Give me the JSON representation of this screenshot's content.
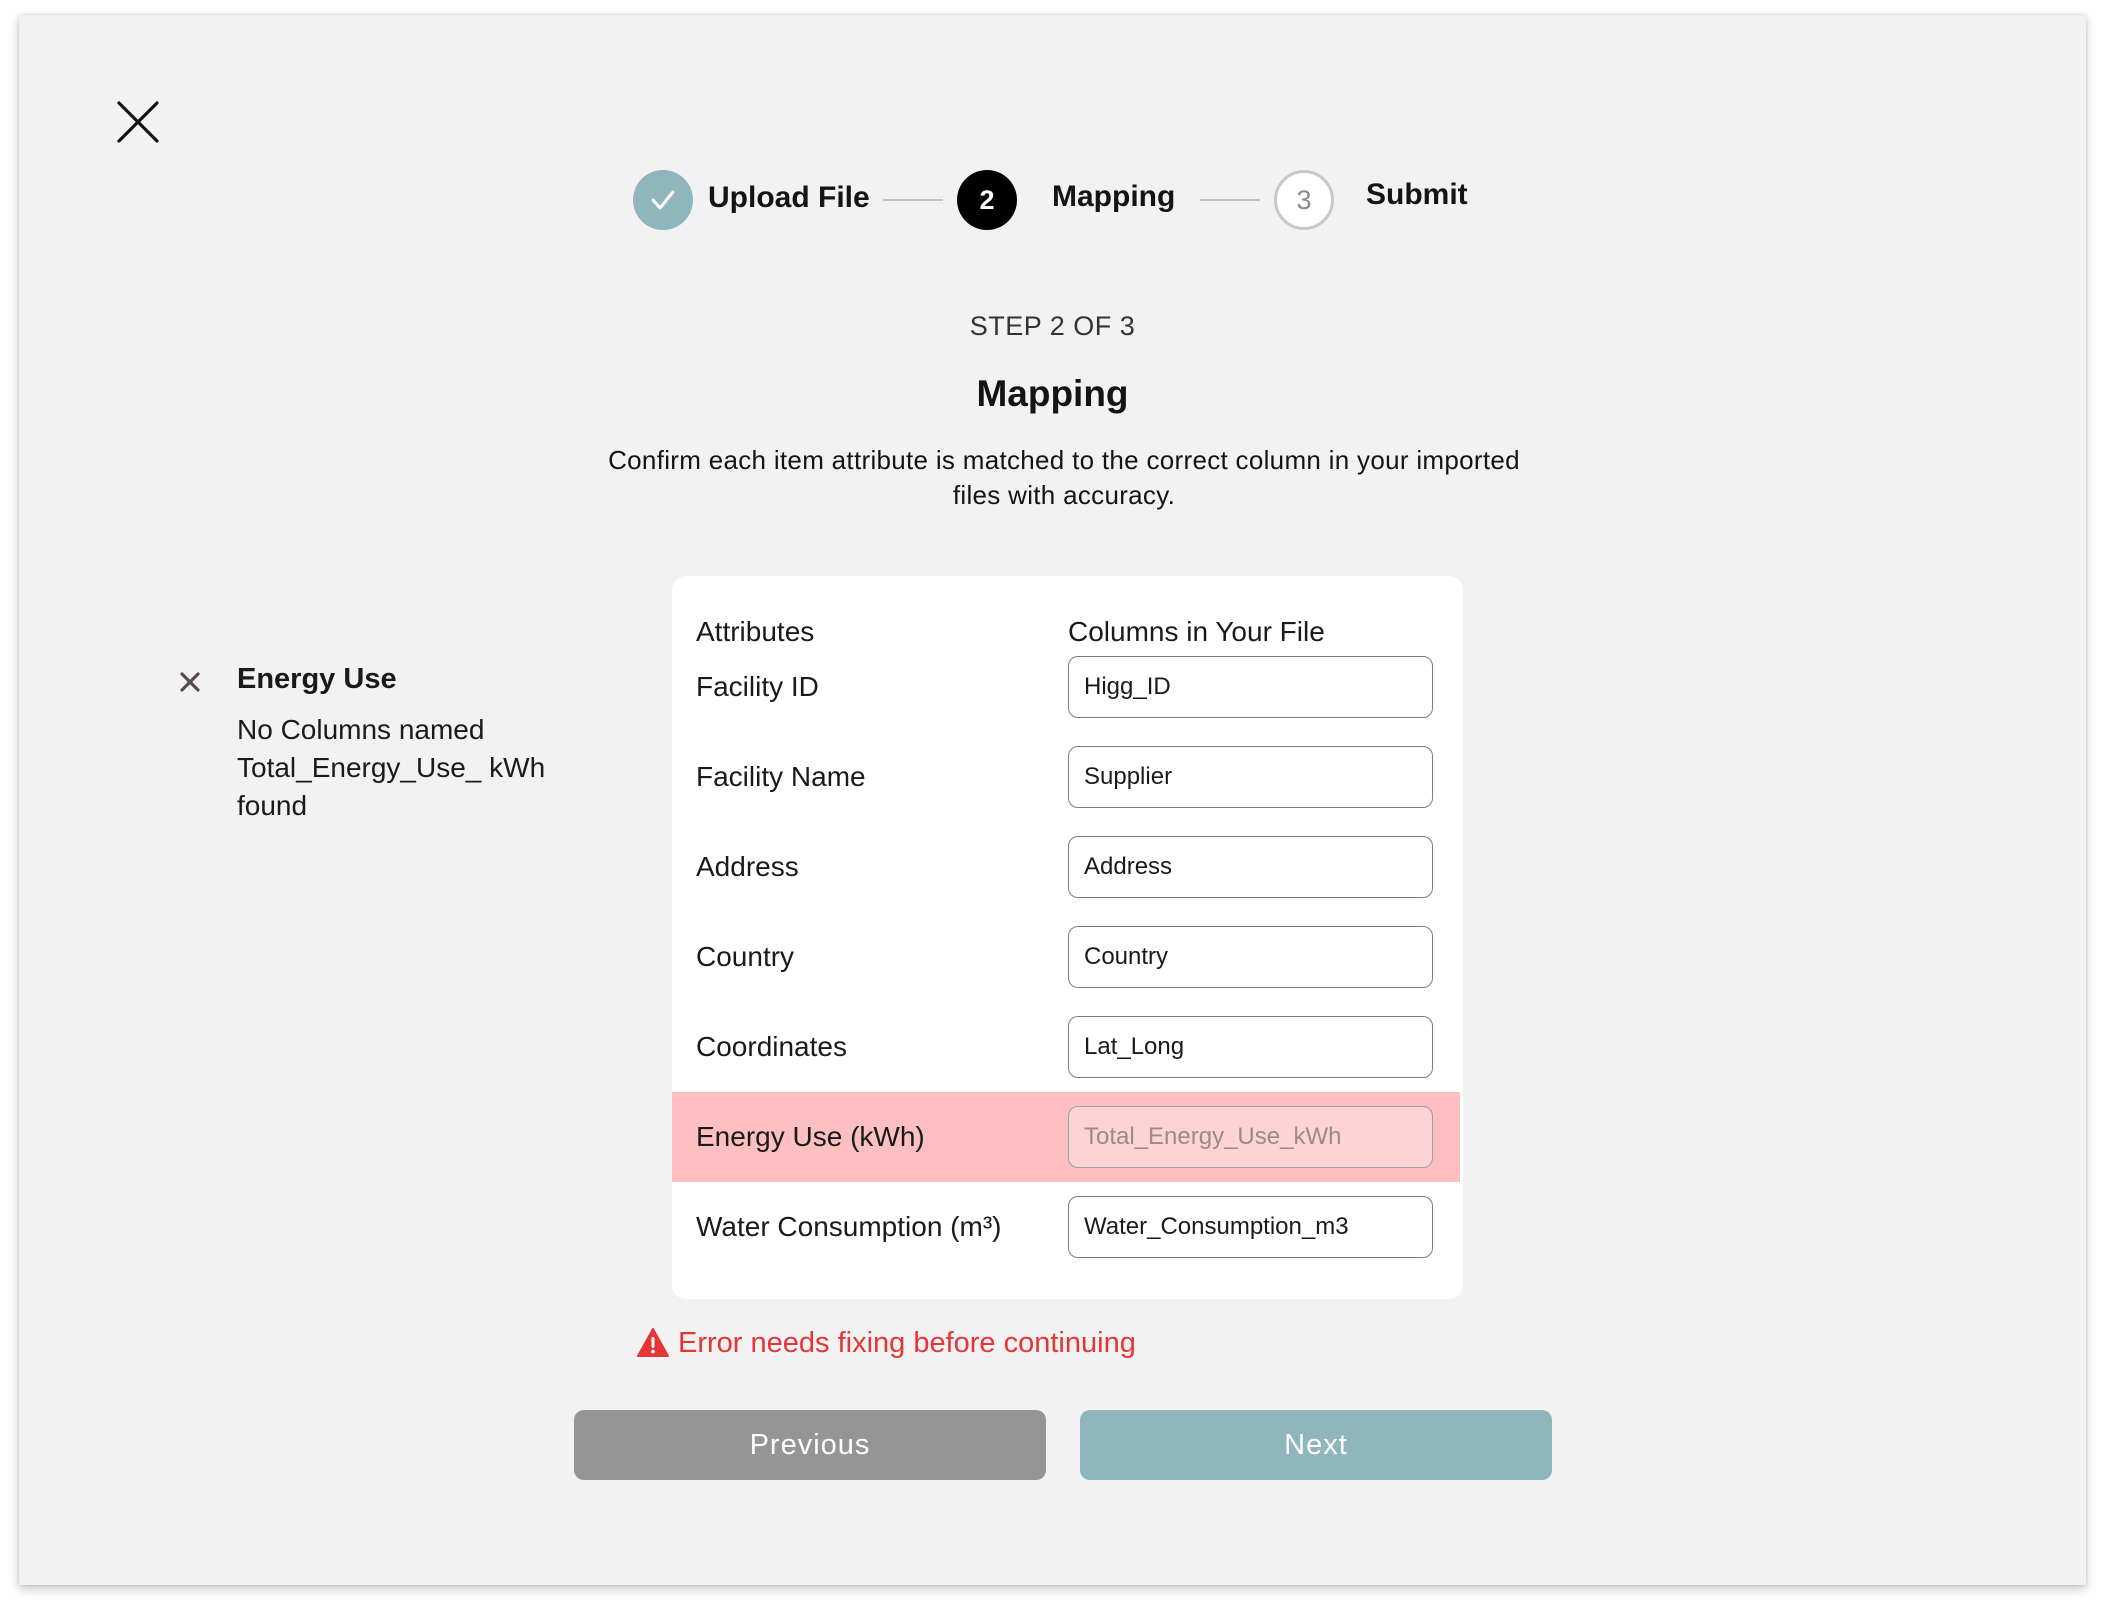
{
  "colors": {
    "background": "#f2f2f2",
    "completed_step": "#8fb6bd",
    "active_step": "#000000",
    "error_row": "#fdbfbf",
    "error_text": "#e63535",
    "previous_button": "#959595",
    "next_button": "#8fb6bd"
  },
  "stepper": {
    "steps": [
      {
        "label": "Upload File",
        "marker": "✓",
        "state": "complete"
      },
      {
        "label": "Mapping",
        "marker": "2",
        "state": "active"
      },
      {
        "label": "Submit",
        "marker": "3",
        "state": "upcoming"
      }
    ]
  },
  "header": {
    "step_count": "STEP 2 OF 3",
    "title": "Mapping",
    "description": "Confirm each item attribute is matched to the correct column in your imported files with accuracy."
  },
  "side_error": {
    "icon": "x-icon",
    "title": "Energy Use",
    "body": "No Columns named Total_Energy_Use_ kWh found"
  },
  "mapping": {
    "attributes_header": "Attributes",
    "columns_header": "Columns in Your File",
    "rows": [
      {
        "attribute": "Facility ID",
        "value": "Higg_ID",
        "placeholder": "",
        "error": false
      },
      {
        "attribute": "Facility Name",
        "value": "Supplier",
        "placeholder": "",
        "error": false
      },
      {
        "attribute": "Address",
        "value": "Address",
        "placeholder": "",
        "error": false
      },
      {
        "attribute": "Country",
        "value": "Country",
        "placeholder": "",
        "error": false
      },
      {
        "attribute": "Coordinates",
        "value": "Lat_Long",
        "placeholder": "",
        "error": false
      },
      {
        "attribute": "Energy Use (kWh)",
        "value": "",
        "placeholder": "Total_Energy_Use_kWh",
        "error": true
      },
      {
        "attribute": "Water Consumption (m³)",
        "value": "Water_Consumption_m3",
        "placeholder": "",
        "error": false
      }
    ]
  },
  "error_message": {
    "icon": "warning-icon",
    "text": "Error needs fixing before continuing"
  },
  "buttons": {
    "previous": "Previous",
    "next": "Next"
  }
}
